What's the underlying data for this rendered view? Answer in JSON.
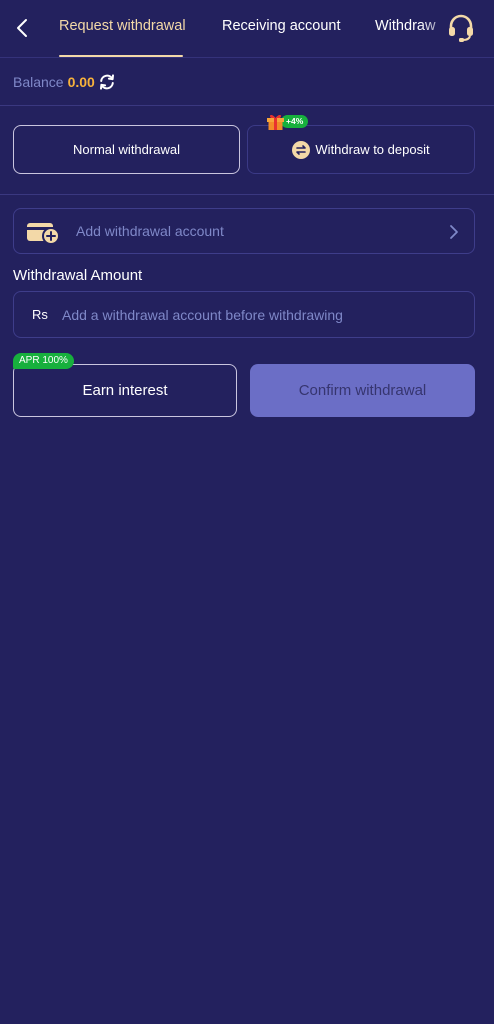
{
  "header": {
    "tabs": [
      {
        "label": "Request withdrawal",
        "active": true
      },
      {
        "label": "Receiving account",
        "active": false
      },
      {
        "label": "Withdraw",
        "active": false
      }
    ]
  },
  "balance": {
    "label": "Balance",
    "value": "0.00"
  },
  "modes": {
    "normal_label": "Normal withdrawal",
    "deposit_label": "Withdraw to deposit",
    "deposit_bonus": "+4%"
  },
  "account": {
    "add_label": "Add withdrawal account"
  },
  "amount": {
    "title": "Withdrawal Amount",
    "currency": "Rs",
    "placeholder": "Add a withdrawal account before withdrawing"
  },
  "actions": {
    "earn_label": "Earn interest",
    "apr_badge": "APR 100%",
    "confirm_label": "Confirm withdrawal"
  },
  "colors": {
    "background": "#23215e",
    "accent_gold": "#f3d9a8",
    "balance_orange": "#f7b23b",
    "badge_green": "#17b03d",
    "confirm_button": "#6b6ec6"
  },
  "icons": {
    "back": "chevron-left-icon",
    "support": "headset-icon",
    "refresh": "refresh-icon",
    "gift": "gift-icon",
    "swap": "swap-icon",
    "wallet": "wallet-add-icon",
    "chevron": "chevron-right-icon"
  }
}
